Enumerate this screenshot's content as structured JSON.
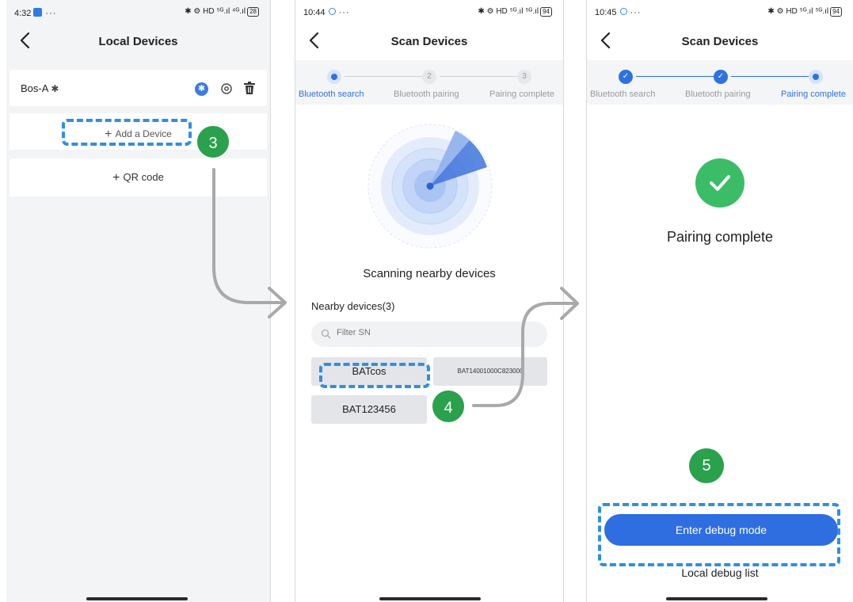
{
  "screen1": {
    "status": {
      "time": "4:32",
      "dots": "···",
      "right": "✱ ⚙ HD ⁵ᴳ.ıl ⁴ᴳ.ıl",
      "battery": "28"
    },
    "title": "Local Devices",
    "device": {
      "name": "Bos-A",
      "bt_glyph": "✱"
    },
    "add_label": "Add a Device",
    "qr_label": "QR code",
    "step_badge": "3"
  },
  "screen2": {
    "status": {
      "time": "10:44",
      "dots": "···",
      "right": "✱ ⚙ HD ⁵ᴳ.ıl ⁵ᴳ.ıl",
      "battery": "94"
    },
    "title": "Scan Devices",
    "steps": [
      {
        "num": "",
        "label": "Bluetooth search"
      },
      {
        "num": "2",
        "label": "Bluetooth pairing"
      },
      {
        "num": "3",
        "label": "Pairing complete"
      }
    ],
    "scan_text": "Scanning nearby devices",
    "nearby_title": "Nearby devices(3)",
    "filter_placeholder": "Filter SN",
    "devices": [
      "BATcos",
      "BAT14001000C823000",
      "BAT123456"
    ],
    "step_badge": "4"
  },
  "screen3": {
    "status": {
      "time": "10:45",
      "dots": "···",
      "right": "✱ ⚙ HD ⁵ᴳ.ıl ⁵ᴳ.ıl",
      "battery": "94"
    },
    "title": "Scan Devices",
    "steps": [
      {
        "label": "Bluetooth search"
      },
      {
        "label": "Bluetooth pairing"
      },
      {
        "label": "Pairing complete"
      }
    ],
    "complete_text": "Pairing complete",
    "step_badge": "5",
    "debug_button": "Enter debug mode",
    "debug_list": "Local debug list"
  },
  "colors": {
    "accent": "#2d72e2",
    "success": "#3bbd67",
    "badge": "#2aa14c",
    "highlight": "#2f8fe2"
  }
}
